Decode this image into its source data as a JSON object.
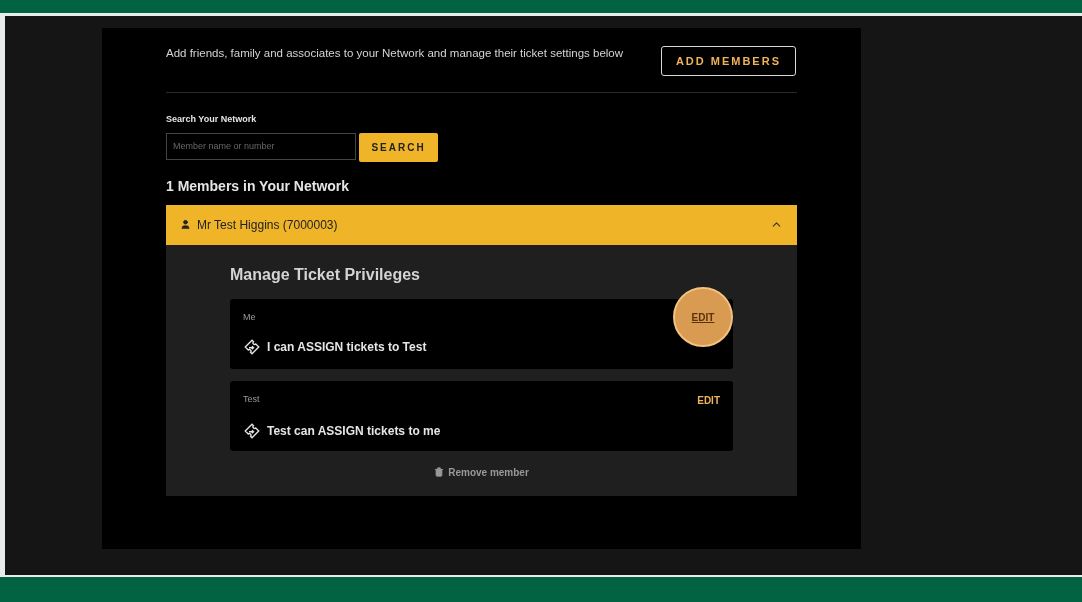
{
  "intro": {
    "text": "Add friends, family and associates to your Network and manage their ticket settings below",
    "add_button": "ADD MEMBERS"
  },
  "search": {
    "label": "Search Your Network",
    "placeholder": "Member name or number",
    "button": "SEARCH"
  },
  "members_heading": "1 Members in Your Network",
  "members": [
    {
      "name": "Mr Test Higgins (7000003)",
      "expanded": true,
      "section_title": "Manage Ticket Privileges",
      "privileges": [
        {
          "owner": "Me",
          "text": "I can ASSIGN tickets to Test",
          "edit": "EDIT",
          "highlighted": true
        },
        {
          "owner": "Test",
          "text": "Test can ASSIGN tickets to me",
          "edit": "EDIT",
          "highlighted": false
        }
      ],
      "remove": "Remove member"
    }
  ]
}
